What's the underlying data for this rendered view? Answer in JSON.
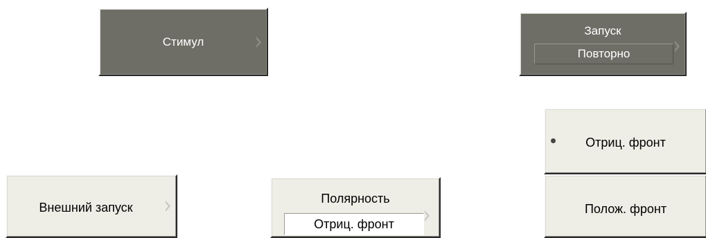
{
  "stimulus_button": {
    "label": "Стимул"
  },
  "trigger_button": {
    "label": "Запуск",
    "value": "Повторно"
  },
  "external_trigger_button": {
    "label": "Внешний запуск"
  },
  "polarity_button": {
    "label": "Полярность",
    "value": "Отриц. фронт"
  },
  "polarity_menu": {
    "options": [
      {
        "label": "Отриц. фронт",
        "selected": true
      },
      {
        "label": "Полож. фронт",
        "selected": false
      }
    ]
  }
}
